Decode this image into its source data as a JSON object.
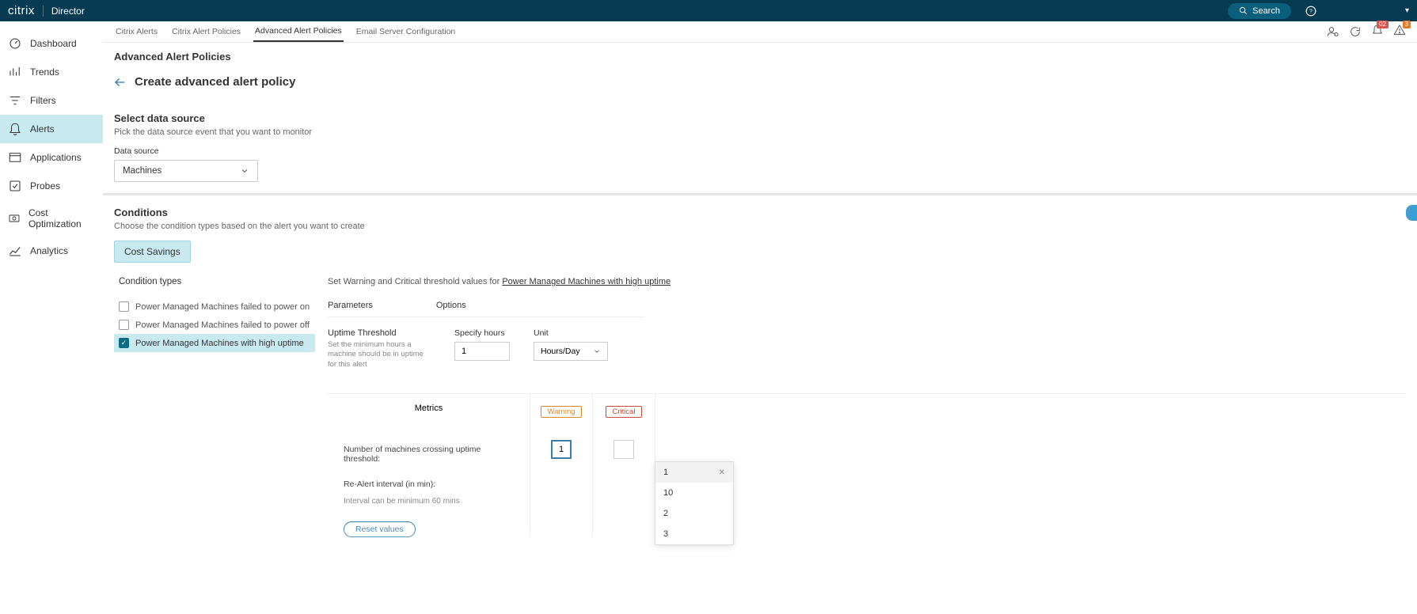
{
  "header": {
    "brand": "citrix",
    "product": "Director",
    "search_label": "Search"
  },
  "sidebar": {
    "items": [
      {
        "label": "Dashboard",
        "icon": "dashboard-icon"
      },
      {
        "label": "Trends",
        "icon": "trends-icon"
      },
      {
        "label": "Filters",
        "icon": "filters-icon"
      },
      {
        "label": "Alerts",
        "icon": "alerts-icon"
      },
      {
        "label": "Applications",
        "icon": "applications-icon"
      },
      {
        "label": "Probes",
        "icon": "probes-icon"
      },
      {
        "label": "Cost Optimization",
        "icon": "cost-icon"
      },
      {
        "label": "Analytics",
        "icon": "analytics-icon"
      }
    ],
    "active_index": 3
  },
  "tabs": {
    "items": [
      "Citrix Alerts",
      "Citrix Alert Policies",
      "Advanced Alert Policies",
      "Email Server Configuration"
    ],
    "active_index": 2
  },
  "notifications": {
    "bell_count": "02",
    "warn_count": "3"
  },
  "page": {
    "title": "Advanced Alert Policies",
    "create_title": "Create advanced alert policy"
  },
  "data_source": {
    "heading": "Select data source",
    "sub": "Pick the data source event that you want to monitor",
    "label": "Data source",
    "value": "Machines"
  },
  "conditions": {
    "heading": "Conditions",
    "sub": "Choose the condition types based on the alert you want to create",
    "pill": "Cost Savings",
    "types_heading": "Condition types",
    "items": [
      {
        "label": "Power Managed Machines failed to power on",
        "checked": false
      },
      {
        "label": "Power Managed Machines failed to power off",
        "checked": false
      },
      {
        "label": "Power Managed Machines with high uptime",
        "checked": true
      }
    ],
    "selected_index": 2
  },
  "thresholds": {
    "intro_prefix": "Set Warning and Critical threshold values for ",
    "intro_link": "Power Managed Machines with high uptime",
    "col_parameters": "Parameters",
    "col_options": "Options",
    "uptime_label": "Uptime Threshold",
    "uptime_desc": "Set the minimum hours a machine should be in uptime for this alert",
    "specify_hours_label": "Specify hours",
    "specify_hours_value": "1",
    "unit_label": "Unit",
    "unit_value": "Hours/Day"
  },
  "metrics": {
    "col_metrics": "Metrics",
    "tag_warning": "Warning",
    "tag_critical": "Critical",
    "row1": "Number of machines crossing uptime threshold:",
    "row1_warning_value": "1",
    "row1_critical_value": "",
    "row2_label": "Re-Alert interval (in min):",
    "row2_sub": "Interval can be minimum 60 mins",
    "reset_label": "Reset values"
  },
  "popup": {
    "options": [
      "1",
      "10",
      "2",
      "3"
    ]
  }
}
